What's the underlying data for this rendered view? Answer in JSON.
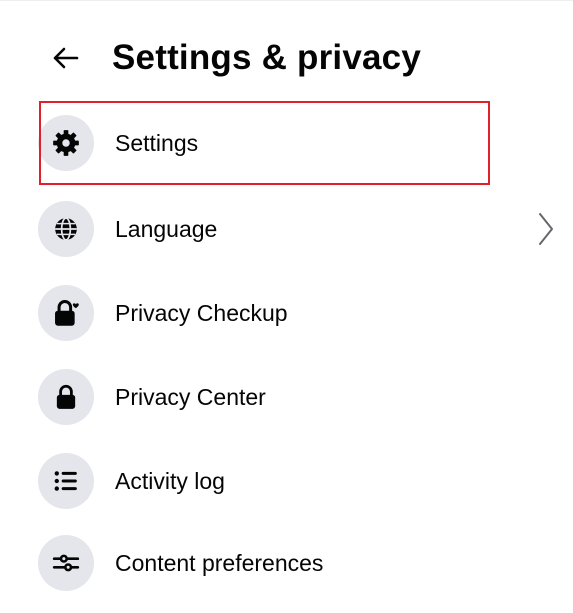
{
  "header": {
    "back_icon": "arrow-left-icon",
    "title": "Settings & privacy"
  },
  "menu": {
    "items": [
      {
        "label": "Settings",
        "icon": "gear-icon",
        "highlighted": true
      },
      {
        "label": "Language",
        "icon": "globe-icon",
        "has_chevron": true,
        "chevron_icon": "chevron-right-icon"
      },
      {
        "label": "Privacy Checkup",
        "icon": "lock-heart-icon"
      },
      {
        "label": "Privacy Center",
        "icon": "lock-icon"
      },
      {
        "label": "Activity log",
        "icon": "list-icon"
      },
      {
        "label": "Content preferences",
        "icon": "sliders-icon"
      }
    ]
  },
  "colors": {
    "icon_background": "#e4e6eb",
    "text": "#050505",
    "highlight_border": "#e0202a",
    "chevron": "#65676b"
  }
}
